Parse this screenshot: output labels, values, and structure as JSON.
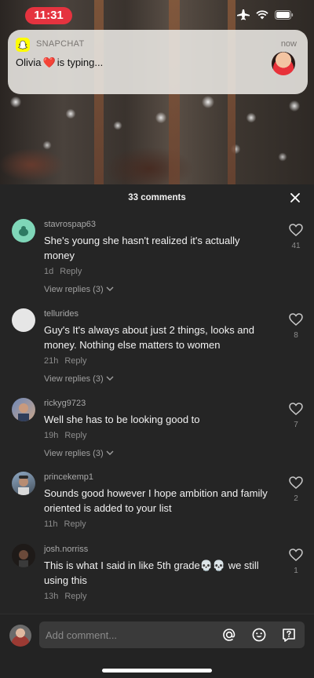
{
  "status_bar": {
    "time": "11:31"
  },
  "notification": {
    "app": "SNAPCHAT",
    "time": "now",
    "sender": "Olivia",
    "heart": "❤️",
    "message": "is typing..."
  },
  "comments_panel": {
    "title": "33 comments",
    "comments": [
      {
        "user": "stavrospap63",
        "text": "She's young she hasn't realized it's actually money",
        "age": "1d",
        "reply": "Reply",
        "replies": "View replies (3)",
        "likes": "41"
      },
      {
        "user": "tellurides",
        "text": "Guy's It's always about just 2 things, looks and money. Nothing else matters to women",
        "age": "21h",
        "reply": "Reply",
        "replies": "View replies (3)",
        "likes": "8"
      },
      {
        "user": "rickyg9723",
        "text": "Well she has to be looking good to",
        "age": "19h",
        "reply": "Reply",
        "replies": "View replies (3)",
        "likes": "7"
      },
      {
        "user": "princekemp1",
        "text": "Sounds good however I hope ambition and family oriented is added to your list",
        "age": "11h",
        "reply": "Reply",
        "replies": "",
        "likes": "2"
      },
      {
        "user": "josh.norriss",
        "text": "This is what I said in like 5th grade💀💀 we still using this",
        "age": "13h",
        "reply": "Reply",
        "replies": "",
        "likes": "1"
      }
    ]
  },
  "input_bar": {
    "placeholder": "Add comment..."
  },
  "colors": {
    "accent_red": "#e5333f",
    "panel_bg": "#252525",
    "snapchat_yellow": "#fffc00"
  }
}
